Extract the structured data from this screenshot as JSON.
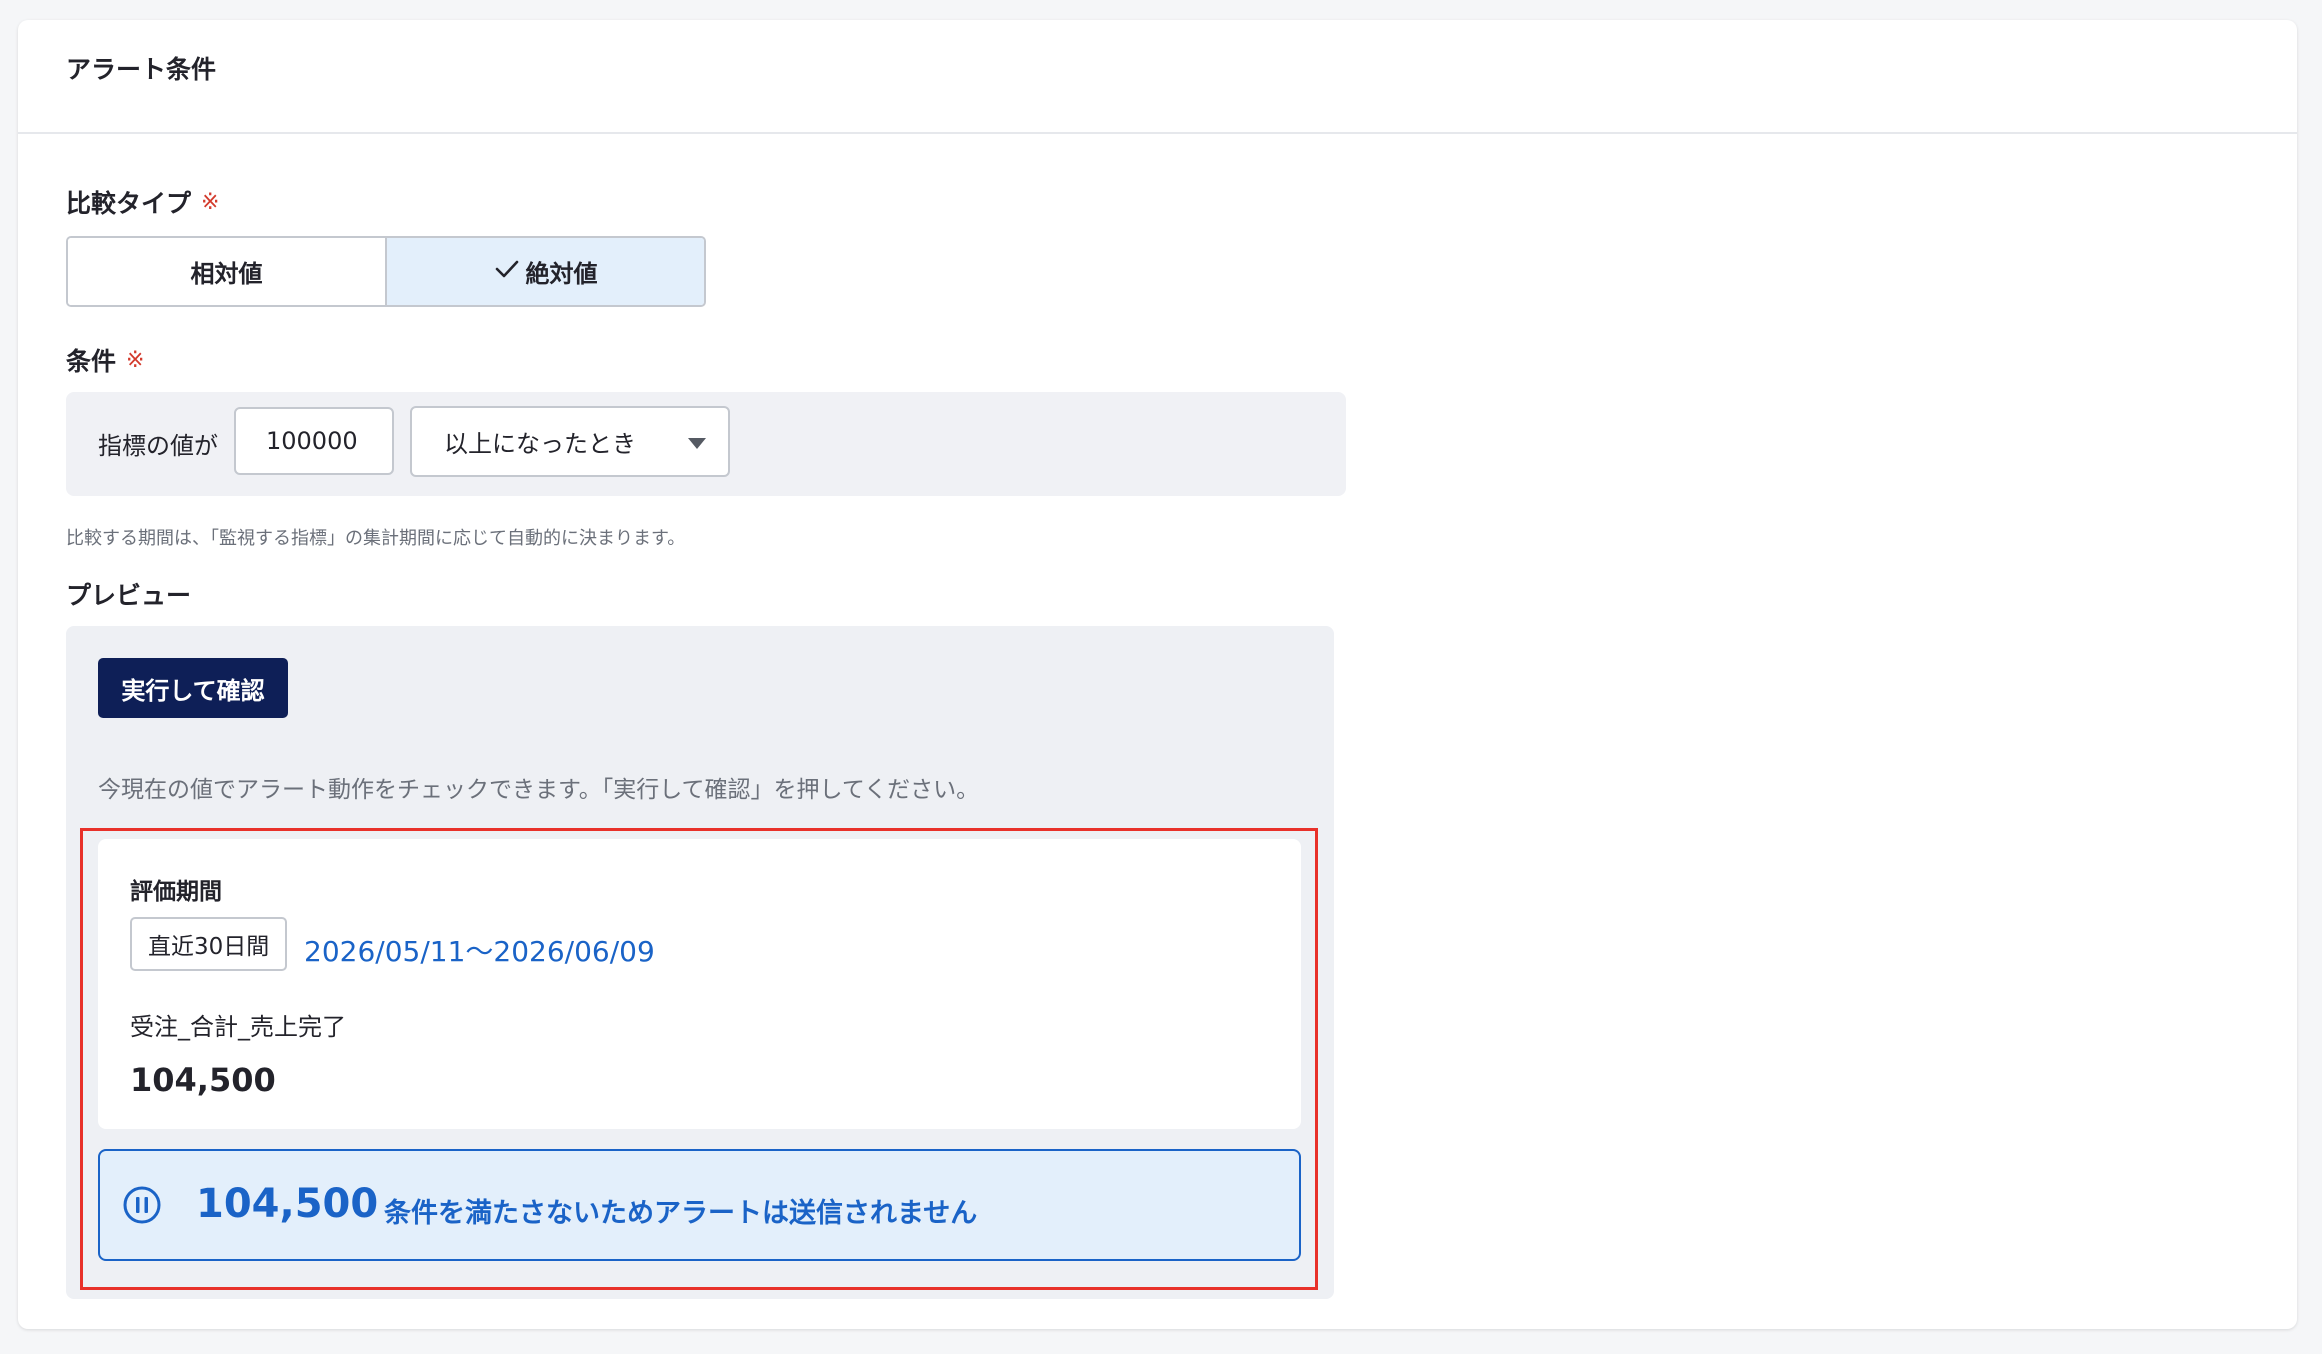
{
  "section": {
    "title": "アラート条件"
  },
  "comparison": {
    "label": "比較タイプ",
    "required_mark": "※",
    "options": [
      {
        "label": "相対値",
        "selected": false
      },
      {
        "label": "絶対値",
        "selected": true
      }
    ],
    "check_icon": "check-icon"
  },
  "condition": {
    "label": "条件",
    "required_mark": "※",
    "prefix": "指標の値が",
    "value": "100000",
    "operator": "以上になったとき",
    "helper": "比較する期間は、「監視する指標」の集計期間に応じて自動的に決まります。"
  },
  "preview": {
    "label": "プレビュー",
    "run_button": "実行して確認",
    "hint": "今現在の値でアラート動作をチェックできます。「実行して確認」を押してください。",
    "result": {
      "period_title": "評価期間",
      "period_tag": "直近30日間",
      "period_range": "2026/05/11〜2026/06/09",
      "metric_name": "受注_合計_売上完了",
      "metric_value": "104,500"
    },
    "status": {
      "icon": "pause-circle-icon",
      "value": "104,500",
      "message": "条件を満たさないためアラートは送信されません"
    }
  },
  "colors": {
    "accent": "#1a63c7",
    "primary_button": "#0e1f57",
    "required": "#d33a2c",
    "highlight_border": "#e8312a",
    "selected_bg": "#e3effb"
  }
}
